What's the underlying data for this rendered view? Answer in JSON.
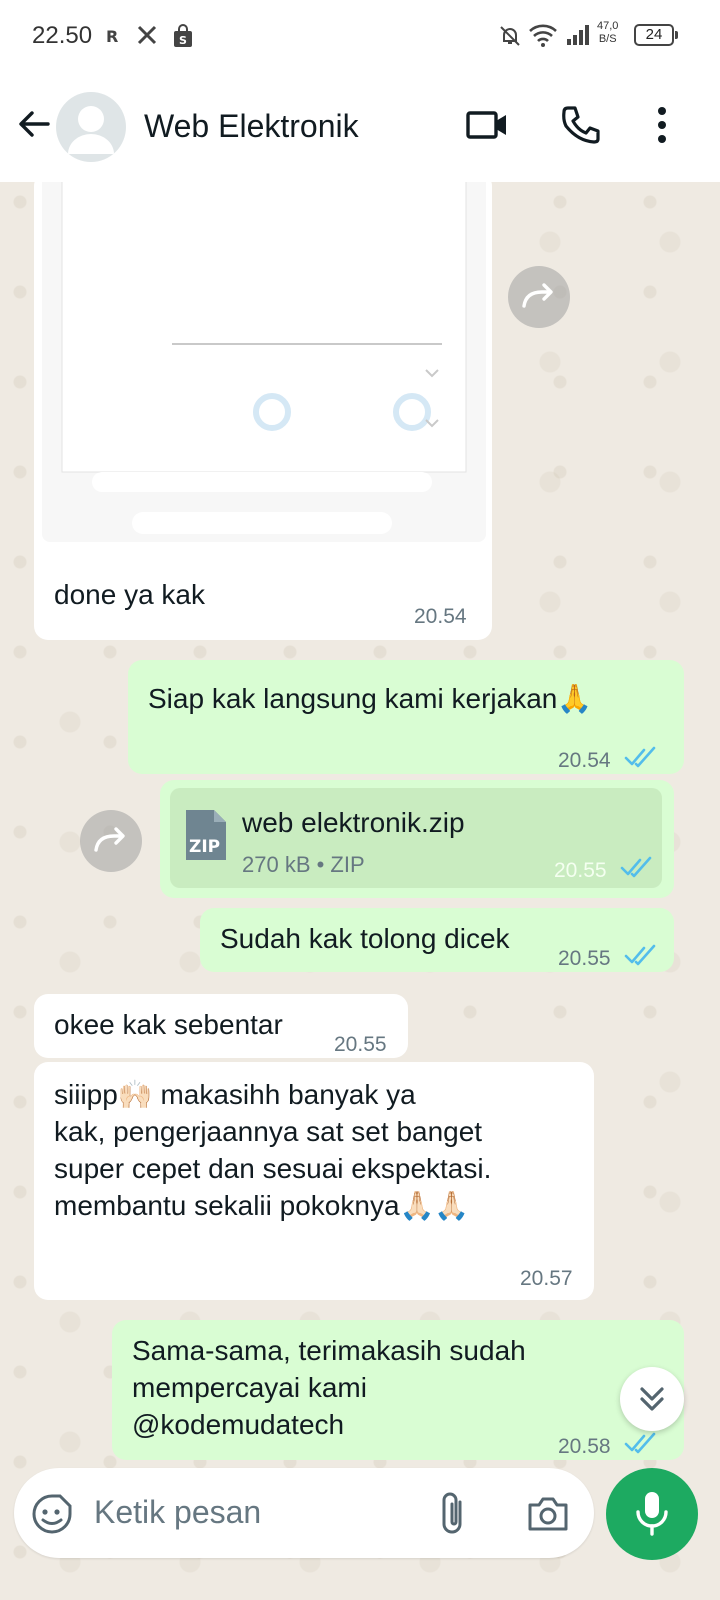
{
  "status_bar": {
    "time": "22.50",
    "net_speed_value": "47,0",
    "net_speed_unit": "B/S",
    "battery": "24",
    "icons": [
      "r-notification-icon",
      "x-icon",
      "shop-bag-icon",
      "mute-icon",
      "wifi-icon",
      "signal-icon"
    ]
  },
  "header": {
    "contact_name": "Web Elektronik",
    "icons": [
      "back-arrow-icon",
      "video-call-icon",
      "voice-call-icon",
      "more-vert-icon"
    ]
  },
  "messages": [
    {
      "dir": "in",
      "type": "image",
      "caption": "done ya kak",
      "time": "20.54"
    },
    {
      "dir": "out",
      "text": "Siap kak langsung kami kerjakan🙏",
      "time": "20.54",
      "read": true
    },
    {
      "dir": "out",
      "type": "file",
      "file_name": "web elektronik.zip",
      "file_meta": "270 kB • ZIP",
      "file_badge": "ZIP",
      "time": "20.55",
      "read": true
    },
    {
      "dir": "out",
      "text": "Sudah kak tolong dicek",
      "time": "20.55",
      "read": true
    },
    {
      "dir": "in",
      "text": "okee kak sebentar",
      "time": "20.55"
    },
    {
      "dir": "in",
      "lines": [
        "siiipp🙌🏻 makasihh banyak ya",
        "kak, pengerjaannya sat set banget",
        "super cepet dan sesuai ekspektasi.",
        "membantu sekalii pokoknya🙏🏻🙏🏻"
      ],
      "time": "20.57"
    },
    {
      "dir": "out",
      "lines": [
        "Sama-sama, terimakasih sudah",
        "mempercayai kami",
        "@kodemudatech"
      ],
      "time": "20.58",
      "read": true
    }
  ],
  "input": {
    "placeholder": "Ketik pesan",
    "icons": [
      "sticker-icon",
      "attach-icon",
      "camera-icon",
      "mic-icon"
    ]
  },
  "colors": {
    "incoming_bubble": "#ffffff",
    "outgoing_bubble": "#d9fdd3",
    "read_ticks": "#53bdeb",
    "mic_button": "#1daa61",
    "chat_background": "#efeae2"
  }
}
